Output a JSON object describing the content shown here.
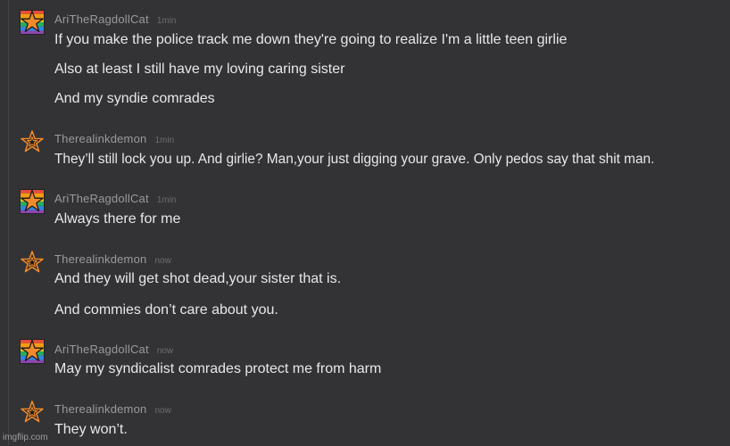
{
  "messages": [
    {
      "user": "AriTheRagdollCat",
      "time": "1min",
      "avatar": "pride-star",
      "lines": [
        "If you make the police track me down they're going to realize I'm a little teen girlie",
        "Also at least I still have my loving caring sister",
        "And my syndie comrades"
      ]
    },
    {
      "user": "Therealinkdemon",
      "time": "1min",
      "avatar": "outline-star",
      "lines": [
        "They’ll still lock you up. And girlie? Man,your just digging your grave. Only pedos say that shit man."
      ]
    },
    {
      "user": "AriTheRagdollCat",
      "time": "1min",
      "avatar": "pride-star",
      "lines": [
        "Always there for me"
      ]
    },
    {
      "user": "Therealinkdemon",
      "time": "now",
      "avatar": "outline-star",
      "lines": [
        "And they will get shot dead,your sister that is.",
        "And commies don’t care about you."
      ]
    },
    {
      "user": "AriTheRagdollCat",
      "time": "now",
      "avatar": "pride-star",
      "lines": [
        "May my syndicalist comrades protect me from harm"
      ]
    },
    {
      "user": "Therealinkdemon",
      "time": "now",
      "avatar": "outline-star",
      "lines": [
        "They won’t."
      ]
    }
  ],
  "watermark": "imgflip.com",
  "colors": {
    "background": "#333335",
    "username": "#9a9a9c",
    "timestamp": "#6d6d70",
    "message_text": "#e8e8ea",
    "star_orange": "#f08a2c"
  }
}
